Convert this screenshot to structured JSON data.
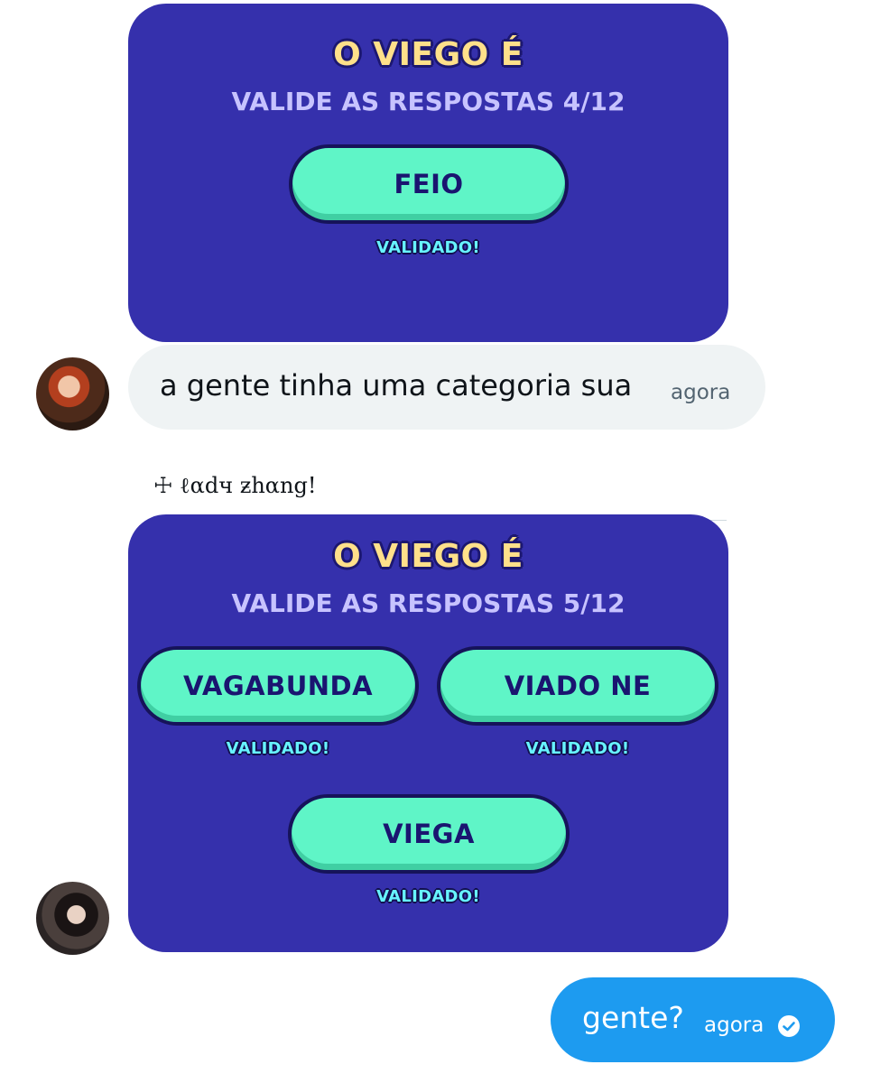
{
  "card1": {
    "title": "O VIEGO É",
    "subtitle": "VALIDE AS RESPOSTAS 4/12",
    "answers": [
      {
        "label": "FEIO",
        "status": "VALIDADO!"
      }
    ]
  },
  "incoming": {
    "text": "a gente tinha uma categoria sua",
    "time": "agora"
  },
  "sender": {
    "name": "☩ ℓαdч ƶhαng!"
  },
  "card2": {
    "title": "O VIEGO É",
    "subtitle": "VALIDE AS RESPOSTAS 5/12",
    "answers": [
      {
        "label": "VAGABUNDA",
        "status": "VALIDADO!"
      },
      {
        "label": "VIADO NE",
        "status": "VALIDADO!"
      },
      {
        "label": "VIEGA",
        "status": "VALIDADO!"
      }
    ]
  },
  "outgoing": {
    "text": "gente?",
    "time": "agora",
    "status_icon": "check-circle-icon"
  },
  "colors": {
    "card_bg": "#3530ac",
    "answer_pill": "#5ff5c7",
    "title_gold": "#ffe08a",
    "validated_cyan": "#67f3ff",
    "outgoing_bubble": "#1d9bf0",
    "incoming_bubble": "#eff3f4"
  }
}
